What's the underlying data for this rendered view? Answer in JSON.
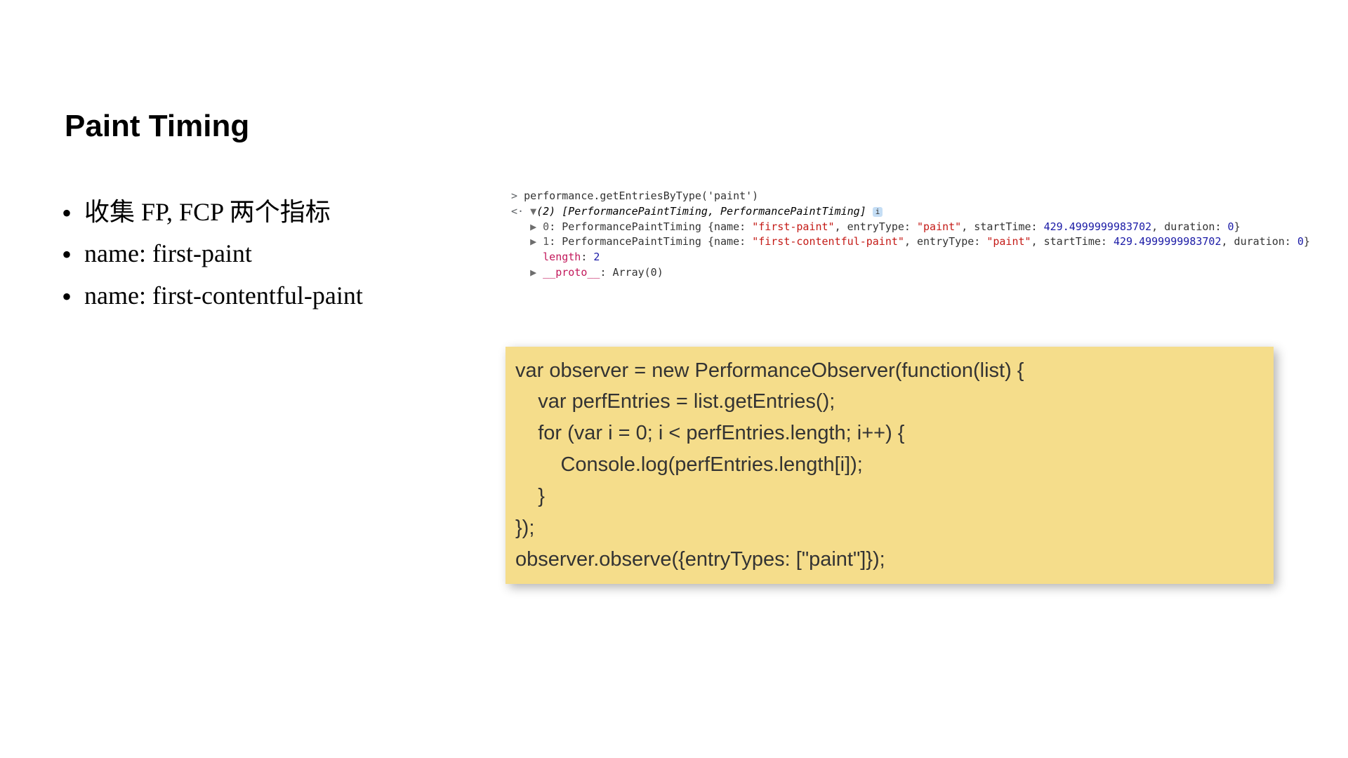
{
  "title": "Paint Timing",
  "bullets": [
    "收集 FP, FCP 两个指标",
    "name: first-paint",
    "name: first-contentful-paint"
  ],
  "console": {
    "input": "performance.getEntriesByType('paint')",
    "badge": "i",
    "summary_prefix": "(2) ",
    "summary_types": "[PerformancePaintTiming, PerformancePaintTiming]",
    "entries": [
      {
        "idx": "0",
        "type": "PerformancePaintTiming",
        "name": "\"first-paint\"",
        "entryType": "\"paint\"",
        "startTime": "429.4999999983702",
        "duration": "0"
      },
      {
        "idx": "1",
        "type": "PerformancePaintTiming",
        "name": "\"first-contentful-paint\"",
        "entryType": "\"paint\"",
        "startTime": "429.4999999983702",
        "duration": "0"
      }
    ],
    "length_label": "length",
    "length_value": "2",
    "proto_label": "__proto__",
    "proto_value": "Array(0)"
  },
  "code": {
    "l1": "var observer = new PerformanceObserver(function(list) {",
    "l2": "    var perfEntries = list.getEntries();",
    "l3": "    for (var i = 0; i < perfEntries.length; i++) {",
    "l4": "        Console.log(perfEntries.length[i]);",
    "l5": "    }",
    "l6": "});",
    "l7": "observer.observe({entryTypes: [\"paint\"]});"
  }
}
